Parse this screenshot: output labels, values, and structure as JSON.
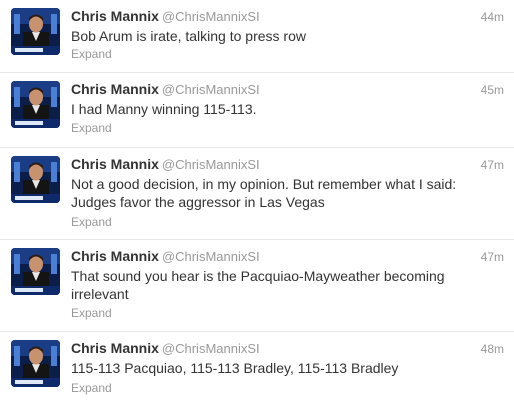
{
  "tweets": [
    {
      "name": "Chris Mannix",
      "handle": "@ChrisMannixSI",
      "time": "44m",
      "text": "Bob Arum is irate, talking to press row",
      "expand": "Expand"
    },
    {
      "name": "Chris Mannix",
      "handle": "@ChrisMannixSI",
      "time": "45m",
      "text": "I had Manny winning 115-113.",
      "expand": "Expand"
    },
    {
      "name": "Chris Mannix",
      "handle": "@ChrisMannixSI",
      "time": "47m",
      "text": "Not a good decision, in my opinion. But remember what I said: Judges favor the aggressor in Las Vegas",
      "expand": "Expand"
    },
    {
      "name": "Chris Mannix",
      "handle": "@ChrisMannixSI",
      "time": "47m",
      "text": "That sound you hear is the Pacquiao-Mayweather becoming irrelevant",
      "expand": "Expand"
    },
    {
      "name": "Chris Mannix",
      "handle": "@ChrisMannixSI",
      "time": "48m",
      "text": "115-113 Pacquiao, 115-113 Bradley, 115-113 Bradley",
      "expand": "Expand"
    }
  ],
  "colors": {
    "name": "#333333",
    "meta": "#999999",
    "divider": "#e8e8e8"
  },
  "icons": {
    "avatar": "profile-photo-avatar"
  }
}
